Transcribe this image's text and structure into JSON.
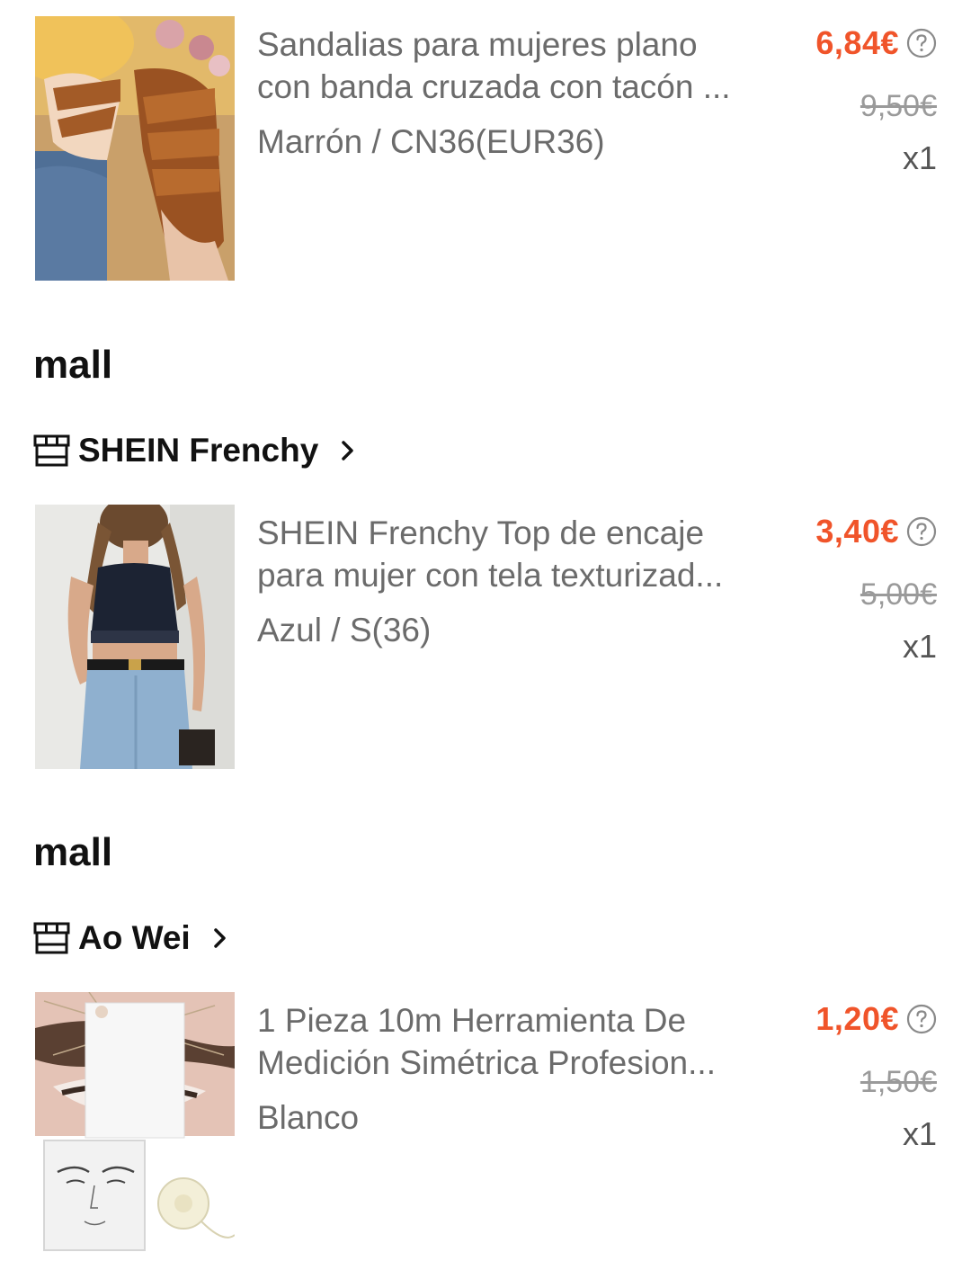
{
  "items": [
    {
      "title_line1": "Sandalias para mujeres plano",
      "title_line2": "con banda cruzada con tacón ...",
      "variant": "Marrón / CN36(EUR36)",
      "price": "6,84€",
      "original_price": "9,50€",
      "quantity": "x1",
      "image": "brown-strappy-sandals"
    },
    {
      "title_line1": "SHEIN Frenchy Top de encaje",
      "title_line2": "para mujer con tela texturizad...",
      "variant": "Azul / S(36)",
      "price": "3,40€",
      "original_price": "5,00€",
      "quantity": "x1",
      "image": "navy-lace-halter-top"
    },
    {
      "title_line1": "1 Pieza 10m Herramienta De",
      "title_line2": "Medición Simétrica Profesion...",
      "variant": "Blanco",
      "price": "1,20€",
      "original_price": "1,50€",
      "quantity": "x1",
      "image": "eyebrow-mapping-string"
    }
  ],
  "sections": [
    {
      "label": "mall",
      "store": "SHEIN Frenchy"
    },
    {
      "label": "mall",
      "store": "Ao Wei"
    }
  ],
  "icons": {
    "store": "store-icon",
    "chevron": "chevron-right-icon",
    "help": "question-circle-icon"
  },
  "colors": {
    "price": "#f0542a",
    "muted_text": "#6b6b6b",
    "strike_text": "#9a9a9a"
  }
}
